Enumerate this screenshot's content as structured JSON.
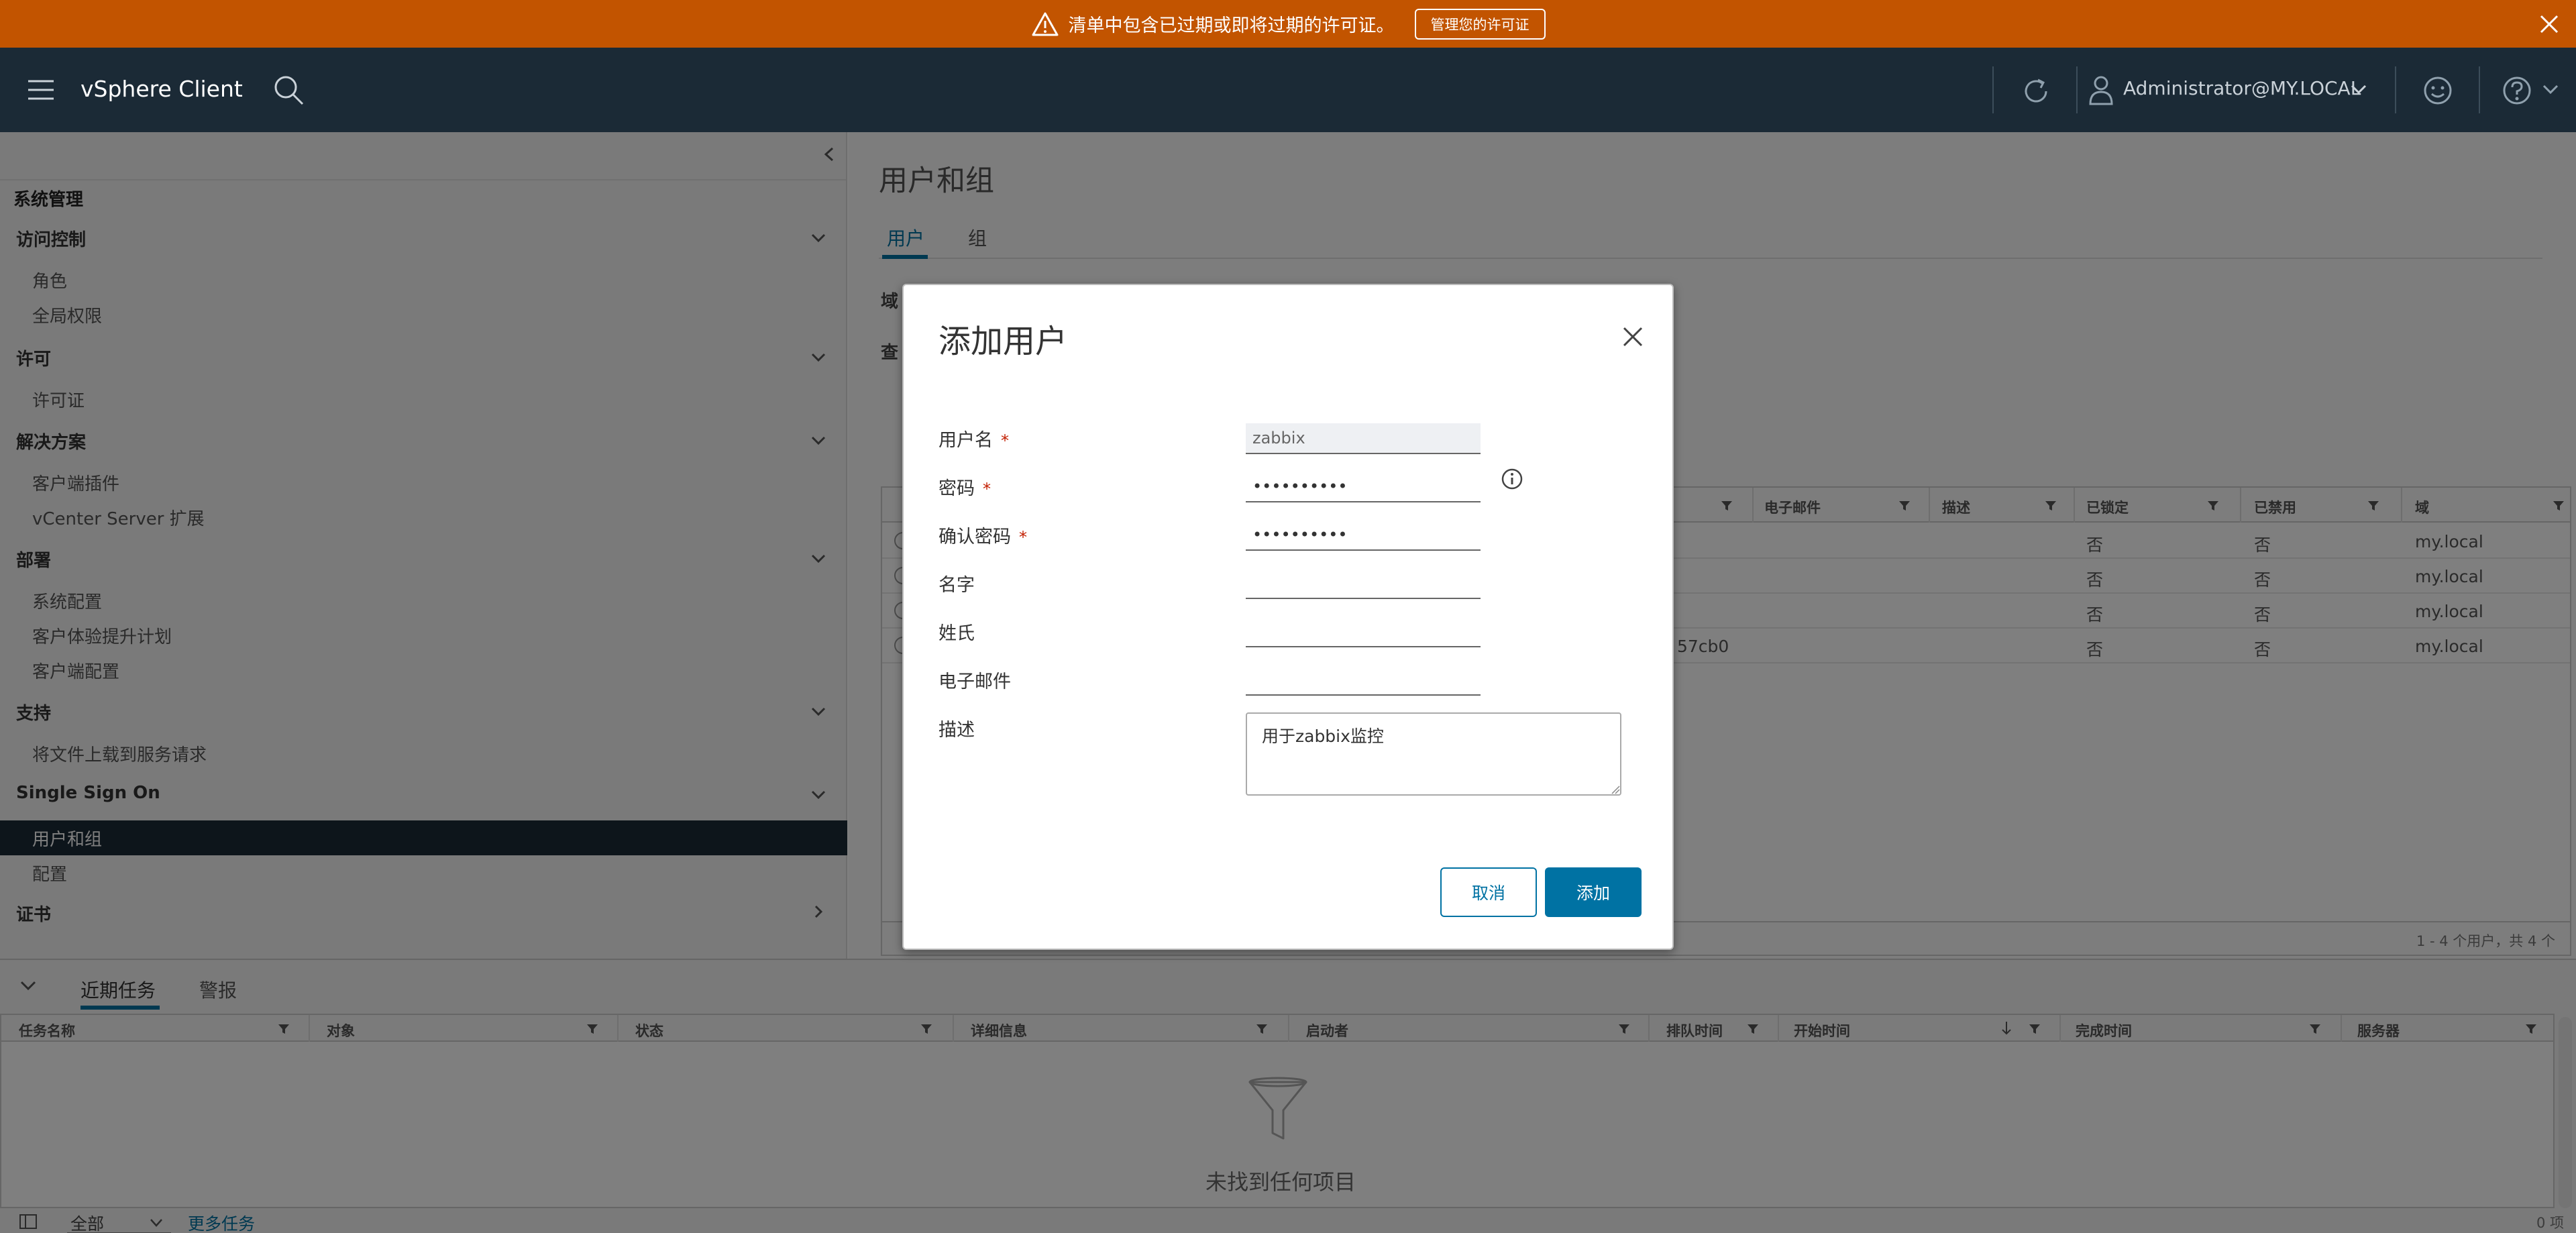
{
  "banner": {
    "message": "清单中包含已过期或即将过期的许可证。",
    "button_label": "管理您的许可证"
  },
  "header": {
    "app_title": "vSphere Client",
    "user": "Administrator@MY.LOCAL"
  },
  "sidebar": {
    "root": "系统管理",
    "sections": [
      {
        "title": "访问控制",
        "items": [
          "角色",
          "全局权限"
        ]
      },
      {
        "title": "许可",
        "items": [
          "许可证"
        ]
      },
      {
        "title": "解决方案",
        "items": [
          "客户端插件",
          "vCenter Server 扩展"
        ]
      },
      {
        "title": "部署",
        "items": [
          "系统配置",
          "客户体验提升计划",
          "客户端配置"
        ]
      },
      {
        "title": "支持",
        "items": [
          "将文件上载到服务请求"
        ]
      },
      {
        "title": "Single Sign On",
        "items": [
          "用户和组",
          "配置"
        ]
      },
      {
        "title": "证书",
        "items": []
      }
    ],
    "active_item": "用户和组"
  },
  "main": {
    "title": "用户和组",
    "tabs": [
      "用户",
      "组"
    ],
    "domain_label": "域",
    "query_label": "查",
    "grid": {
      "columns": [
        "电子邮件",
        "描述",
        "已锁定",
        "已禁用",
        "域"
      ],
      "rows": [
        {
          "partial": "",
          "locked": "否",
          "disabled": "否",
          "domain": "my.local"
        },
        {
          "partial": "",
          "locked": "否",
          "disabled": "否",
          "domain": "my.local"
        },
        {
          "partial": "",
          "locked": "否",
          "disabled": "否",
          "domain": "my.local"
        },
        {
          "partial": "57cb0",
          "locked": "否",
          "disabled": "否",
          "domain": "my.local"
        }
      ],
      "footer": "1 - 4 个用户，共 4 个"
    }
  },
  "modal": {
    "title": "添加用户",
    "fields": {
      "username": {
        "label": "用户名",
        "value": "zabbix",
        "required": "*"
      },
      "password": {
        "label": "密码",
        "value": "••••••••••",
        "required": "*"
      },
      "confirm": {
        "label": "确认密码",
        "value": "••••••••••",
        "required": "*"
      },
      "firstname": {
        "label": "名字",
        "value": ""
      },
      "lastname": {
        "label": "姓氏",
        "value": ""
      },
      "email": {
        "label": "电子邮件",
        "value": ""
      },
      "description": {
        "label": "描述",
        "value": "用于zabbix监控"
      }
    },
    "cancel_label": "取消",
    "add_label": "添加"
  },
  "tasks": {
    "tabs": [
      "近期任务",
      "警报"
    ],
    "columns": [
      "任务名称",
      "对象",
      "状态",
      "详细信息",
      "启动者",
      "排队时间",
      "开始时间",
      "完成时间",
      "服务器"
    ],
    "empty_text": "未找到任何项目",
    "filter_value": "全部",
    "more_label": "更多任务",
    "count": "0 项"
  },
  "colors": {
    "banner": "#c25400",
    "header": "#1b2a36",
    "accent": "#0072a3"
  }
}
